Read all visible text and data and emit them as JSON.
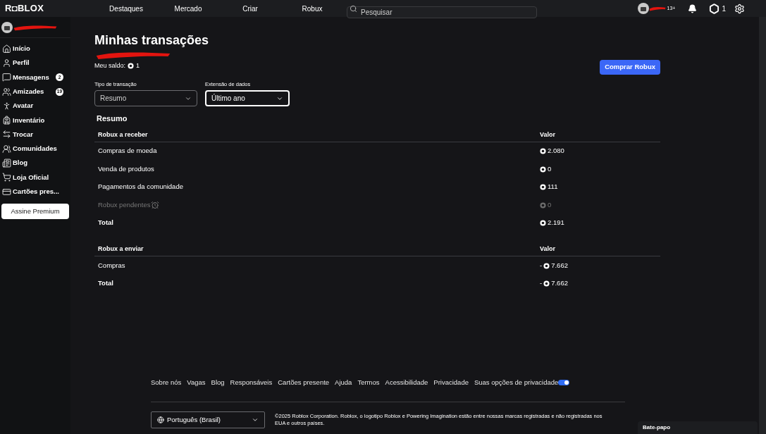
{
  "topbar": {
    "logo": "R◘BLOX",
    "nav": [
      "Destaques",
      "Mercado",
      "Criar",
      "Robux"
    ],
    "search": {
      "placeholder": "Pesquisar"
    },
    "age_badge": "13+",
    "robux_count": "1"
  },
  "sidebar": {
    "items": [
      {
        "label": "Início"
      },
      {
        "label": "Perfil"
      },
      {
        "label": "Mensagens",
        "badge": "2"
      },
      {
        "label": "Amizades",
        "badge": "19"
      },
      {
        "label": "Avatar"
      },
      {
        "label": "Inventário"
      },
      {
        "label": "Trocar"
      },
      {
        "label": "Comunidades"
      },
      {
        "label": "Blog"
      },
      {
        "label": "Loja Oficial"
      },
      {
        "label": "Cartões pres..."
      }
    ],
    "premium_button": "Assine Premium"
  },
  "page": {
    "title": "Minhas transações",
    "balance_label": "Meu saldo:",
    "balance_value": "1",
    "buy_button": "Comprar Robux",
    "filters": [
      {
        "label": "Tipo de transação",
        "value": "Resumo",
        "focused": false
      },
      {
        "label": "Extensão de dados",
        "value": "Último ano",
        "focused": true
      }
    ],
    "summary_heading": "Resumo",
    "tables": [
      {
        "columns": [
          "Robux a receber",
          "Valor"
        ],
        "rows": [
          {
            "kind": "item",
            "label": "Compras de moeda",
            "sign": "",
            "value": "2.080"
          },
          {
            "kind": "item",
            "label": "Venda de produtos",
            "sign": "",
            "value": "0"
          },
          {
            "kind": "item",
            "label": "Pagamentos da comunidade",
            "sign": "",
            "value": "111"
          },
          {
            "kind": "pending",
            "label": "Robux pendentes",
            "sign": "",
            "value": "0"
          },
          {
            "kind": "total",
            "label": "Total",
            "sign": "",
            "value": "2.191"
          }
        ]
      },
      {
        "columns": [
          "Robux a enviar",
          "Valor"
        ],
        "rows": [
          {
            "kind": "item",
            "label": "Compras",
            "sign": "-",
            "value": "7.662"
          },
          {
            "kind": "total",
            "label": "Total",
            "sign": "-",
            "value": "7.662"
          }
        ]
      }
    ]
  },
  "footer": {
    "links": [
      "Sobre nós",
      "Vagas",
      "Blog",
      "Responsáveis",
      "Cartões presente",
      "Ajuda",
      "Termos",
      "Acessibilidade",
      "Privacidade",
      "Suas opções de privacidade"
    ],
    "language": "Português (Brasil)",
    "copyright": "©2025 Roblox Corporation. Roblox, o logotipo Roblox e Powering Imagination estão entre nossas marcas registradas e não registradas nos EUA e outros países."
  },
  "chat": {
    "label": "Bate-papo"
  }
}
